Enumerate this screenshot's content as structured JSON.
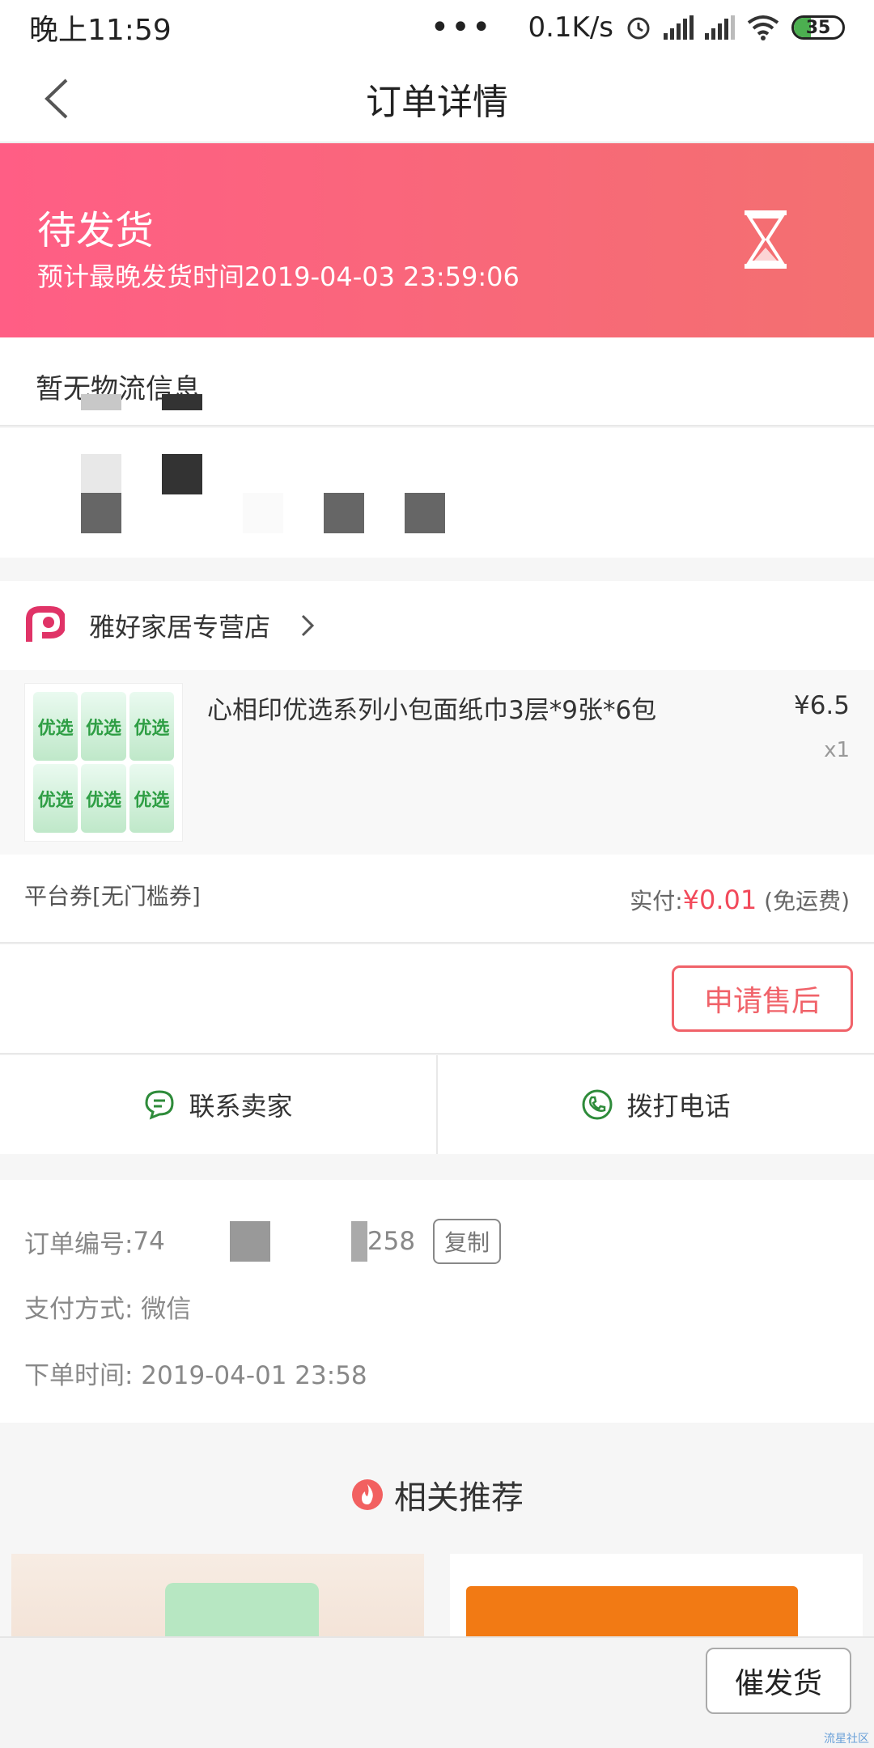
{
  "status_bar": {
    "time": "晚上11:59",
    "dots": "•••",
    "net_speed": "0.1K/s",
    "battery": "35"
  },
  "header": {
    "title": "订单详情"
  },
  "order_status": {
    "label": "待发货",
    "sub": "预计最晚发货时间2019-04-03 23:59:06"
  },
  "logistics": {
    "text": "暂无物流信息"
  },
  "shop": {
    "name": "雅好家居专营店"
  },
  "product": {
    "title": "心相印优选系列小包面纸巾3层*9张*6包",
    "price": "¥6.5",
    "qty": "x1",
    "thumb_text": "优选"
  },
  "payment": {
    "coupon": "平台券[无门槛券]",
    "paid_label": "实付:",
    "paid_amount": "¥0.01",
    "shipping": "(免运费)"
  },
  "actions": {
    "after_sale": "申请售后",
    "contact_seller": "联系卖家",
    "call": "拨打电话",
    "urge": "催发货"
  },
  "order_info": {
    "order_no_label": "订单编号:",
    "order_no_start": "74",
    "order_no_end": "258",
    "copy": "复制",
    "pay_method": "支付方式: 微信",
    "order_time": "下单时间: 2019-04-01 23:58"
  },
  "recommend": {
    "title": "相关推荐"
  },
  "watermark": "流星社区",
  "colors": {
    "banner_start": "#ff5e85",
    "banner_end": "#f37070",
    "accent_red": "#f2495a",
    "green_icon": "#2e8b3a"
  }
}
